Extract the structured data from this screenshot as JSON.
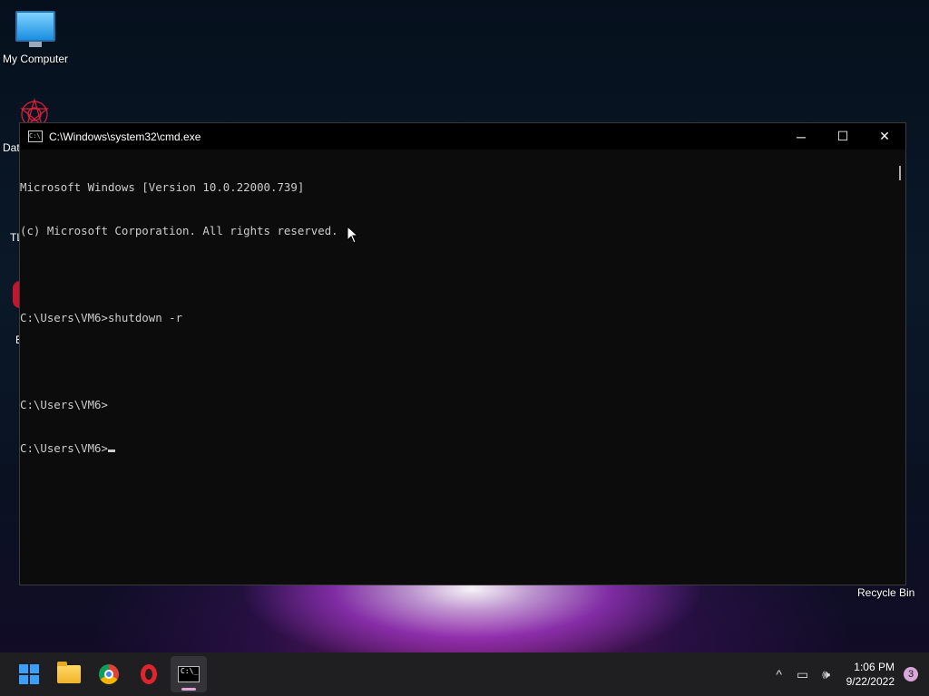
{
  "desktop": {
    "my_computer_label": "My Computer",
    "partial_labels": [
      "Dat",
      "TL",
      "E"
    ],
    "recycle_bin_label": "Recycle Bin"
  },
  "window": {
    "title": "C:\\Windows\\system32\\cmd.exe",
    "icon_text": "C:\\",
    "minimize_glyph": "─",
    "maximize_glyph": "☐",
    "close_glyph": "✕",
    "lines": [
      "Microsoft Windows [Version 10.0.22000.739]",
      "(c) Microsoft Corporation. All rights reserved.",
      "",
      "C:\\Users\\VM6>shutdown -r",
      "",
      "C:\\Users\\VM6>",
      "C:\\Users\\VM6>"
    ]
  },
  "taskbar": {
    "apps": [
      {
        "name": "start-button",
        "icon": "windows-logo-icon"
      },
      {
        "name": "file-explorer-button",
        "icon": "folder-icon"
      },
      {
        "name": "chrome-button",
        "icon": "chrome-icon"
      },
      {
        "name": "opera-button",
        "icon": "opera-icon"
      },
      {
        "name": "cmd-button",
        "icon": "cmd-icon",
        "active": true
      }
    ],
    "cmd_icon_text": "C:\\_",
    "tray": {
      "chevron_glyph": "^",
      "network_glyph": "▭",
      "volume_glyph": "🕪",
      "time": "1:06 PM",
      "date": "9/22/2022",
      "notification_count": "3"
    }
  },
  "colors": {
    "accent_windows": "#3aa0ff",
    "console_text": "#cccccc",
    "console_bg": "#0c0c0c",
    "taskbar_bg": "#1f1f22",
    "badge": "#d9a7d8"
  }
}
